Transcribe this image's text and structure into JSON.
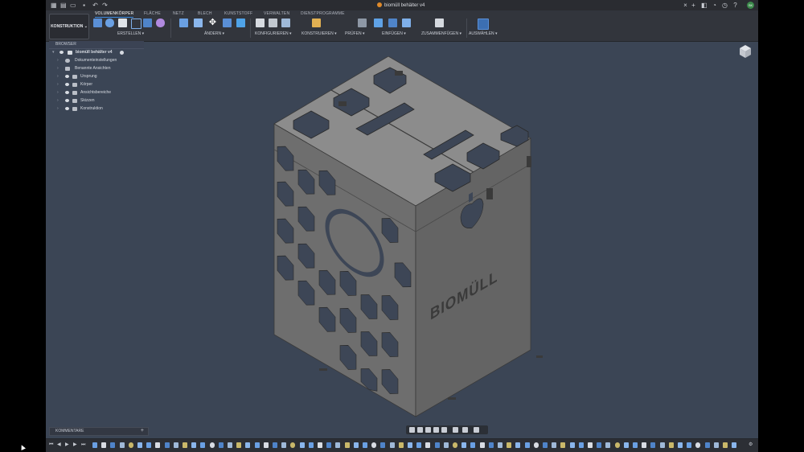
{
  "window": {
    "document_title": "biomüll behälter v4"
  },
  "user": {
    "initials": "SK"
  },
  "workspace": {
    "label": "KONSTRUKTION ⌄"
  },
  "ribbon": {
    "tabs": [
      {
        "label": "VOLUMENKÖRPER",
        "active": true
      },
      {
        "label": "FLÄCHE"
      },
      {
        "label": "NETZ"
      },
      {
        "label": "BLECH"
      },
      {
        "label": "KUNSTSTOFF"
      },
      {
        "label": "VERWALTEN"
      },
      {
        "label": "DIENSTPROGRAMME"
      }
    ],
    "groups": [
      {
        "label": "ERSTELLEN ▾"
      },
      {
        "label": "ÄNDERN ▾"
      },
      {
        "label": "KONFIGURIEREN ▾"
      },
      {
        "label": "KONSTRUIEREN ▾"
      },
      {
        "label": "PRÜFEN ▾"
      },
      {
        "label": "EINFÜGEN ▾"
      },
      {
        "label": "ZUSAMMENFÜGEN ▾"
      },
      {
        "label": "AUSWÄHLEN ▾"
      }
    ]
  },
  "browser": {
    "title": "BROWSER",
    "root": "biomüll behälter v4",
    "items": [
      {
        "label": "Dokumenteinstellungen"
      },
      {
        "label": "Benannte Ansichten"
      },
      {
        "label": "Ursprung"
      },
      {
        "label": "Körper"
      },
      {
        "label": "Ansichtsbereiche"
      },
      {
        "label": "Skizzen"
      },
      {
        "label": "Konstruktion"
      }
    ]
  },
  "model": {
    "engraved_text": "BIOMÜLL"
  },
  "comments": {
    "label": "KOMMENTARE",
    "add": "+"
  },
  "colors": {
    "accent": "#3c8be0",
    "viewport": "#3b4555",
    "model": "#6f6f6f"
  }
}
